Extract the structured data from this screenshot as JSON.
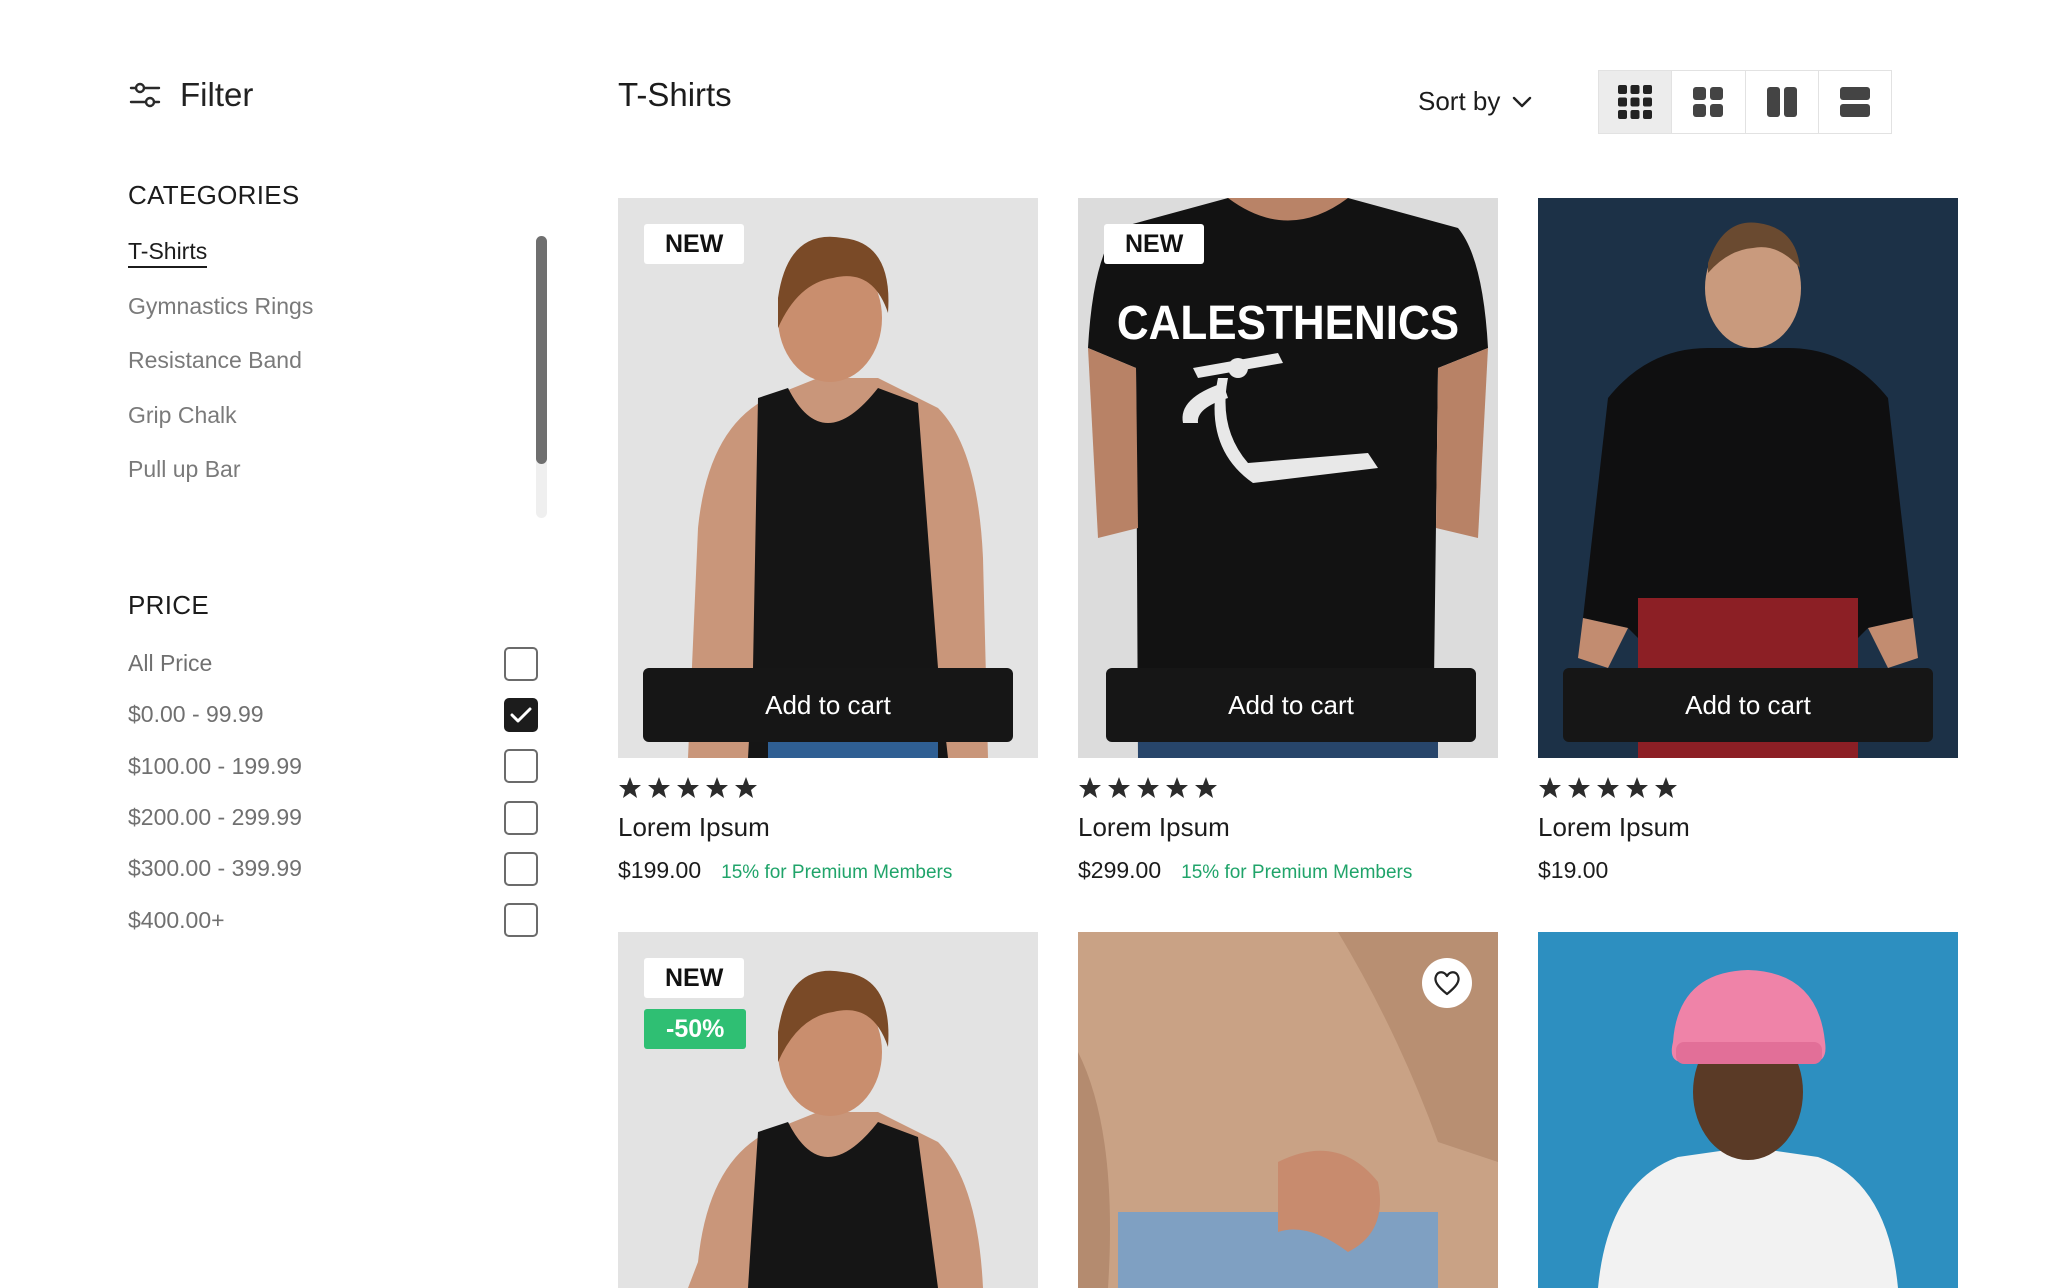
{
  "filter": {
    "label": "Filter"
  },
  "categories": {
    "title": "CATEGORIES",
    "items": [
      "T-Shirts",
      "Gymnastics Rings",
      "Resistance Band",
      "Grip Chalk",
      "Pull up Bar"
    ],
    "active": 0
  },
  "price": {
    "title": "PRICE",
    "options": [
      {
        "label": "All Price",
        "checked": false
      },
      {
        "label": "$0.00 - 99.99",
        "checked": true
      },
      {
        "label": "$100.00 - 199.99",
        "checked": false
      },
      {
        "label": "$200.00 - 299.99",
        "checked": false
      },
      {
        "label": "$300.00 - 399.99",
        "checked": false
      },
      {
        "label": "$400.00+",
        "checked": false
      }
    ]
  },
  "header": {
    "title": "T-Shirts",
    "sort_label": "Sort by",
    "view_modes": [
      "grid-4-icon",
      "grid-2x2-icon",
      "columns-2-icon",
      "rows-2-icon"
    ],
    "active_view": 0
  },
  "products": [
    {
      "badge": "NEW",
      "cart_label": "Add to cart",
      "rating": 5,
      "name": "Lorem Ipsum",
      "price": "$199.00",
      "promo": "15% for Premium Members"
    },
    {
      "badge": "NEW",
      "cart_label": "Add to cart",
      "rating": 5,
      "name": "Lorem Ipsum",
      "price": "$299.00",
      "promo": "15% for Premium Members",
      "shirt_print": "CALESTHENICS"
    },
    {
      "cart_label": "Add to cart",
      "rating": 5,
      "name": "Lorem Ipsum",
      "price": "$19.00"
    },
    {
      "badge": "NEW",
      "discount": "-50%"
    },
    {
      "wishlist": true
    },
    {}
  ],
  "colors": {
    "accent_green": "#2fbf73",
    "promo_green": "#20a46a",
    "dark": "#161616"
  }
}
